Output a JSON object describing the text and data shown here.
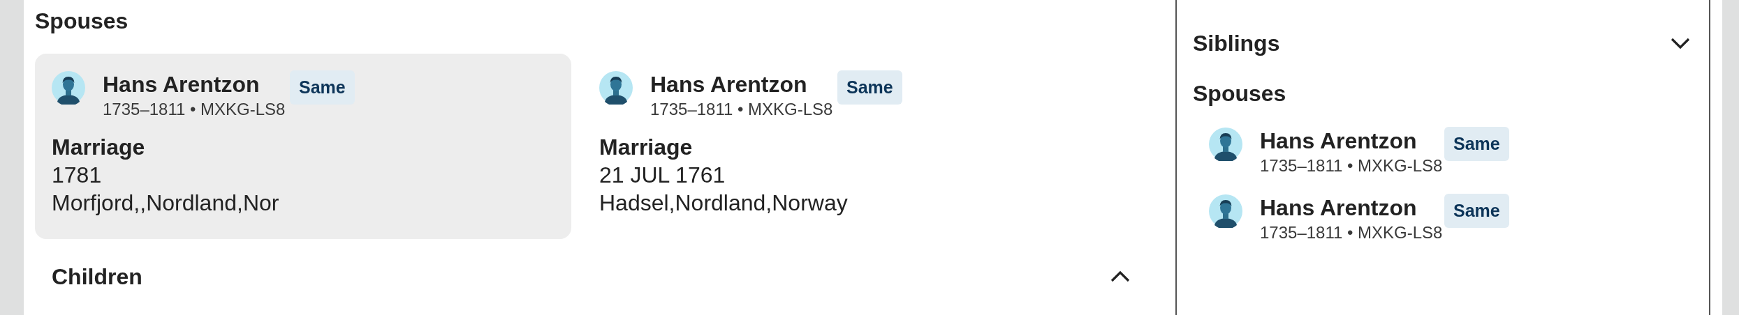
{
  "main": {
    "spouses_heading": "Spouses",
    "spouses": [
      {
        "name": "Hans Arentzon",
        "lifespan": "1735–1811 • MXKG-LS8",
        "badge": "Same",
        "event_title": "Marriage",
        "event_date": "1781",
        "event_place": "Morfjord,,Nordland,Nor",
        "selected": true
      },
      {
        "name": "Hans Arentzon",
        "lifespan": "1735–1811 • MXKG-LS8",
        "badge": "Same",
        "event_title": "Marriage",
        "event_date": "21 JUL 1761",
        "event_place": "Hadsel,Nordland,Norway",
        "selected": false
      }
    ],
    "children_section": {
      "title": "Children",
      "expanded": true
    }
  },
  "side_panel": {
    "siblings_section": {
      "title": "Siblings",
      "expanded": false
    },
    "spouses_heading": "Spouses",
    "spouses": [
      {
        "name": "Hans Arentzon",
        "lifespan": "1735–1811 • MXKG-LS8",
        "badge": "Same"
      },
      {
        "name": "Hans Arentzon",
        "lifespan": "1735–1811 • MXKG-LS8",
        "badge": "Same"
      }
    ]
  }
}
